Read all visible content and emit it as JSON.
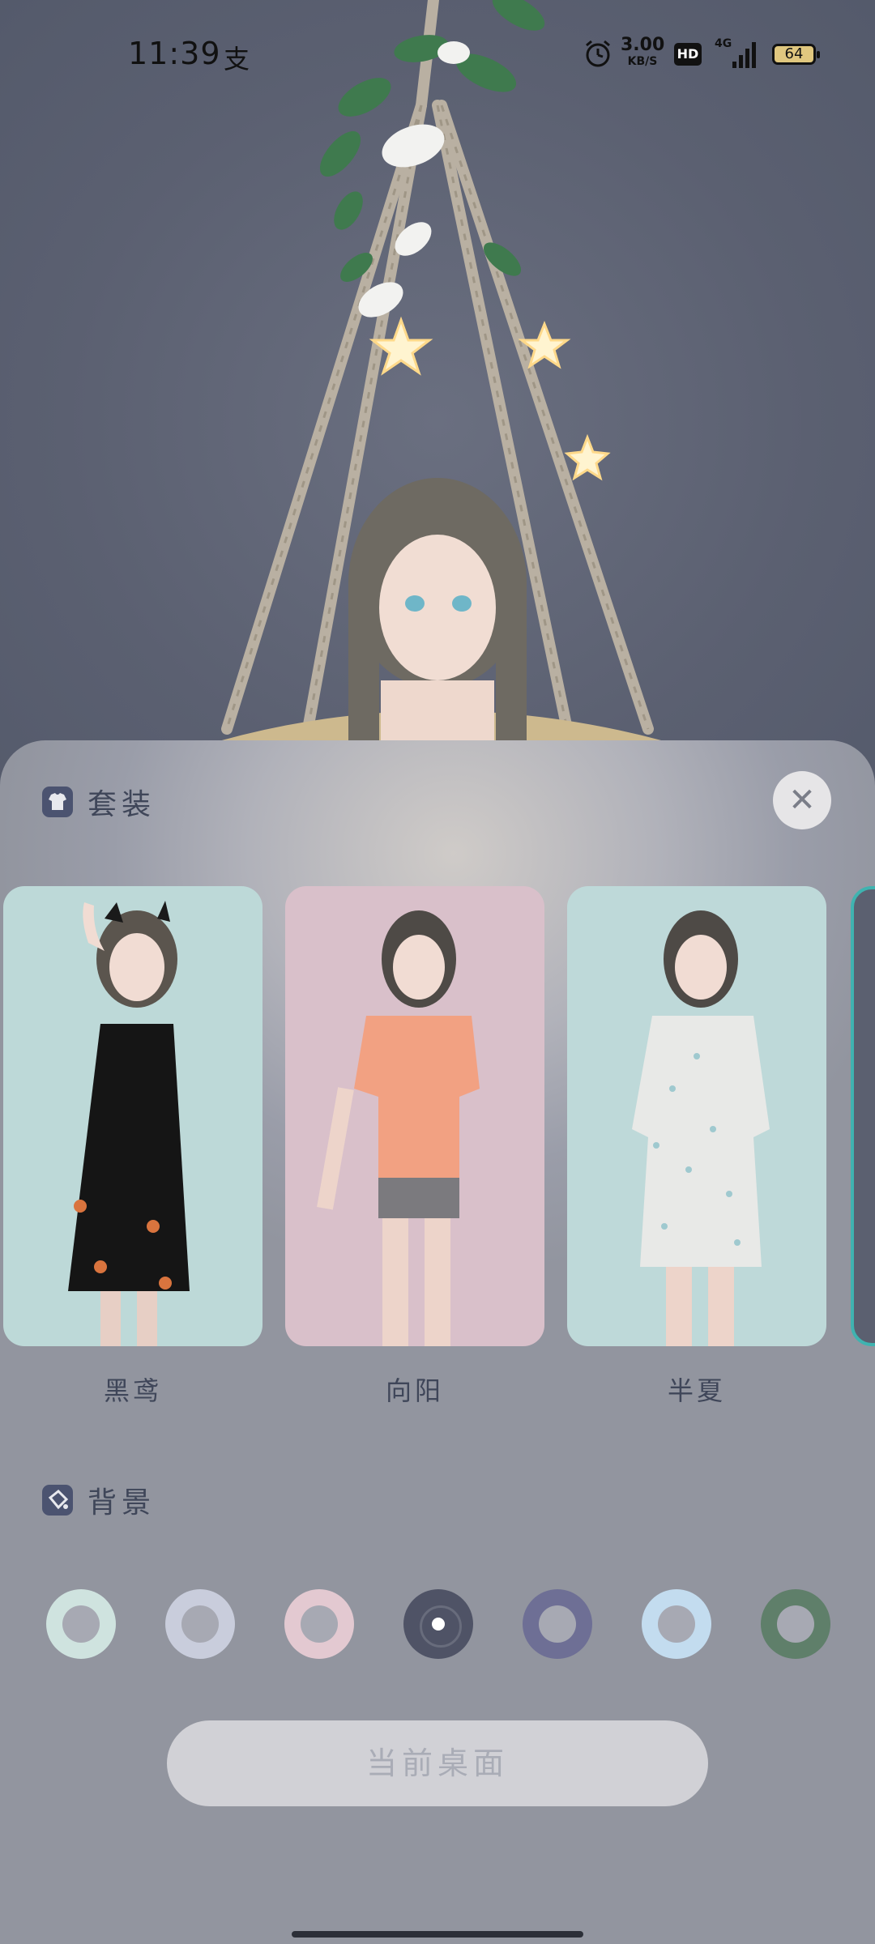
{
  "status_bar": {
    "time": "11:39",
    "notification_icon": "支",
    "alarm_icon": "alarm-icon",
    "net_speed_value": "3.00",
    "net_speed_unit": "KB/S",
    "hd_label": "HD",
    "network_label": "4G",
    "battery_level": "64"
  },
  "outfit_section": {
    "title": "套装",
    "icon": "shirt-icon",
    "close_icon": "close-icon",
    "close_glyph": "✕",
    "cards": [
      {
        "name": "黑鸢",
        "bg": "#bdd9d8"
      },
      {
        "name": "向阳",
        "bg": "#d9c0ca"
      },
      {
        "name": "半夏",
        "bg": "#bed9d9"
      }
    ]
  },
  "background_section": {
    "title": "背景",
    "icon": "paint-bucket-icon",
    "swatches": [
      {
        "color": "#cfe3df",
        "selected": false
      },
      {
        "color": "#c9cddc",
        "selected": false
      },
      {
        "color": "#e3c9d1",
        "selected": false
      },
      {
        "color": "#4f5366",
        "selected": true
      },
      {
        "color": "#6e6f95",
        "selected": false
      },
      {
        "color": "#c3dcef",
        "selected": false
      },
      {
        "color": "#5f7f6a",
        "selected": false
      }
    ]
  },
  "action_button": {
    "label": "当前桌面"
  },
  "colors": {
    "scene_bg": "#5d6273",
    "accent_text": "#3f4659",
    "peek_border": "#3fb3b0"
  }
}
